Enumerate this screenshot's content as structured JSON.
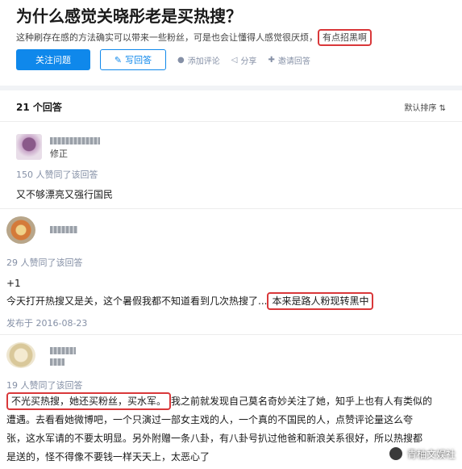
{
  "question": {
    "title": "为什么感觉关晓彤老是买热搜？",
    "desc_main": "这种刷存在感的方法确实可以带来一些粉丝，可是也会让懂得人感觉很厌烦，",
    "desc_highlight": "有点招黑啊"
  },
  "actions": {
    "follow": "关注问题",
    "write_icon": "✎",
    "write": "写回答",
    "comment_icon": "●",
    "comment": "添加评论",
    "share_icon": "◁",
    "share": "分享",
    "invite_icon": "✚",
    "invite": "邀请回答"
  },
  "answers_header": {
    "count": "21 个回答",
    "sort": "默认排序 ⇅"
  },
  "answers": [
    {
      "headline": "修正",
      "votes": "150 人赞同了该回答",
      "text": "又不够漂亮又强行国民"
    },
    {
      "votes": "29 人赞同了该回答",
      "text1": "+1",
      "text2_main": "今天打开热搜又是关，这个暑假我都不知道看到几次热搜了...",
      "text2_highlight": "本来是路人粉现转黑中",
      "date": "发布于 2016-08-23"
    },
    {
      "votes": "19 人赞同了该回答",
      "text_highlight": "不光买热搜，她还买粉丝，买水军。",
      "text_rest_1": "我之前就发现自己莫名奇妙关注了她，知乎上也有人有类似的",
      "text_rest_2": "遭遇。去看看她微博吧，一个只演过一部女主戏的人，一个真的不国民的人，点赞评论量这么夸",
      "text_rest_3": "张，这水军请的不要太明显。另外附赠一条八卦，有八卦号扒过他爸和新浪关系很好，所以热搜都",
      "text_rest_4": "是送的，怪不得像不要钱一样天天上，太恶心了"
    }
  ],
  "watermark": "青柚文娱社"
}
